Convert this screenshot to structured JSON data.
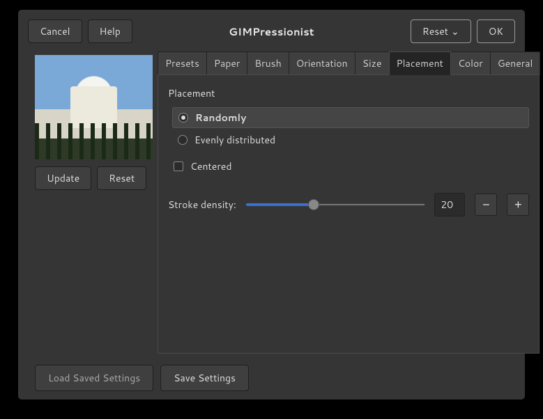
{
  "header": {
    "cancel": "Cancel",
    "help": "Help",
    "title": "GIMPressionist",
    "reset": "Reset",
    "ok": "OK"
  },
  "left": {
    "update": "Update",
    "reset": "Reset"
  },
  "tabs": [
    "Presets",
    "Paper",
    "Brush",
    "Orientation",
    "Size",
    "Placement",
    "Color",
    "General"
  ],
  "active_tab": 5,
  "panel": {
    "section": "Placement",
    "radio_randomly": "Randomly",
    "radio_even": "Evenly distributed",
    "check_centered": "Centered",
    "slider_label": "Stroke density:",
    "slider_value": "20"
  },
  "footer": {
    "load": "Load Saved Settings",
    "save": "Save Settings"
  }
}
